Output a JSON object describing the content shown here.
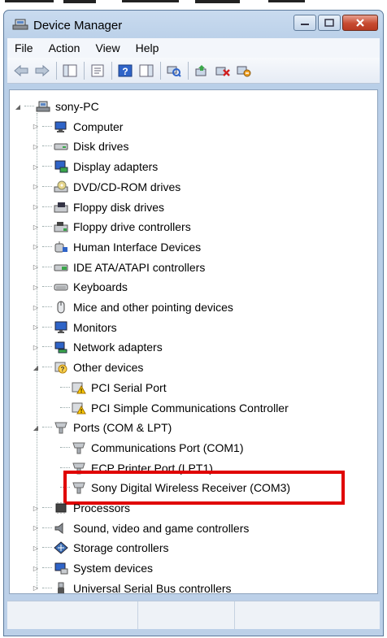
{
  "window": {
    "title": "Device Manager"
  },
  "menu": [
    "File",
    "Action",
    "View",
    "Help"
  ],
  "toolbar": {
    "buttons": [
      {
        "name": "back-icon"
      },
      {
        "name": "forward-icon"
      },
      {
        "name": "show-hide-console-tree-icon"
      },
      {
        "name": "properties-icon"
      },
      {
        "name": "help-icon"
      },
      {
        "name": "show-action-pane-icon"
      },
      {
        "name": "scan-hardware-icon"
      },
      {
        "name": "update-driver-icon"
      },
      {
        "name": "uninstall-icon"
      },
      {
        "name": "disable-icon"
      }
    ]
  },
  "tree": {
    "root": "sony-PC",
    "categories": [
      {
        "label": "Computer",
        "icon": "computer-icon"
      },
      {
        "label": "Disk drives",
        "icon": "disk-drive-icon"
      },
      {
        "label": "Display adapters",
        "icon": "display-adapter-icon"
      },
      {
        "label": "DVD/CD-ROM drives",
        "icon": "dvd-drive-icon"
      },
      {
        "label": "Floppy disk drives",
        "icon": "floppy-drive-icon"
      },
      {
        "label": "Floppy drive controllers",
        "icon": "floppy-controller-icon"
      },
      {
        "label": "Human Interface Devices",
        "icon": "hid-icon"
      },
      {
        "label": "IDE ATA/ATAPI controllers",
        "icon": "ide-controller-icon"
      },
      {
        "label": "Keyboards",
        "icon": "keyboard-icon"
      },
      {
        "label": "Mice and other pointing devices",
        "icon": "mouse-icon"
      },
      {
        "label": "Monitors",
        "icon": "monitor-icon"
      },
      {
        "label": "Network adapters",
        "icon": "network-adapter-icon"
      },
      {
        "label": "Other devices",
        "icon": "unknown-device-icon",
        "expanded": true,
        "children": [
          {
            "label": "PCI Serial Port",
            "icon": "warning-device-icon"
          },
          {
            "label": "PCI Simple Communications Controller",
            "icon": "warning-device-icon"
          }
        ]
      },
      {
        "label": "Ports (COM & LPT)",
        "icon": "port-icon",
        "expanded": true,
        "children": [
          {
            "label": "Communications Port (COM1)",
            "icon": "port-icon"
          },
          {
            "label": "ECP Printer Port (LPT1)",
            "icon": "port-icon"
          },
          {
            "label": "Sony Digital Wireless Receiver (COM3)",
            "icon": "port-icon",
            "highlighted": true
          }
        ]
      },
      {
        "label": "Processors",
        "icon": "processor-icon"
      },
      {
        "label": "Sound, video and game controllers",
        "icon": "sound-icon"
      },
      {
        "label": "Storage controllers",
        "icon": "storage-controller-icon"
      },
      {
        "label": "System devices",
        "icon": "system-device-icon"
      },
      {
        "label": "Universal Serial Bus controllers",
        "icon": "usb-icon"
      }
    ]
  },
  "colors": {
    "highlight_border": "#e00000",
    "title_bar": "#c9dbef"
  }
}
